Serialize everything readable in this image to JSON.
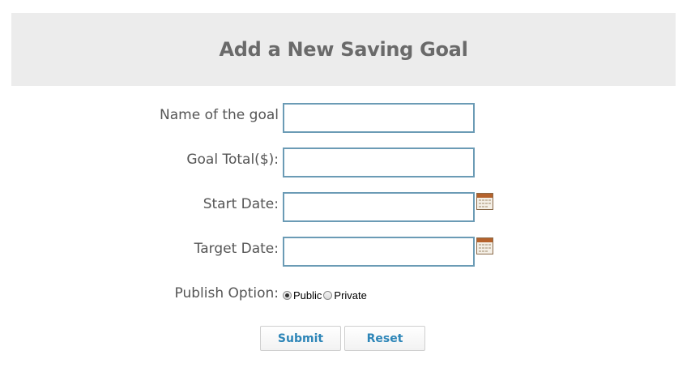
{
  "header": {
    "title": "Add a New Saving Goal"
  },
  "form": {
    "name": {
      "label": "Name of the goal",
      "value": ""
    },
    "total": {
      "label": "Goal Total($):",
      "value": ""
    },
    "start_date": {
      "label": "Start Date:",
      "value": ""
    },
    "target_date": {
      "label": "Target Date:",
      "value": ""
    },
    "publish": {
      "label": "Publish Option:",
      "options": [
        {
          "label": "Public",
          "selected": true
        },
        {
          "label": "Private",
          "selected": false
        }
      ]
    }
  },
  "buttons": {
    "submit": "Submit",
    "reset": "Reset"
  },
  "colors": {
    "input_border": "#6b9bb5",
    "button_text": "#2e86b8",
    "header_bg": "#ececec"
  },
  "icons": {
    "calendar": "calendar-icon"
  }
}
